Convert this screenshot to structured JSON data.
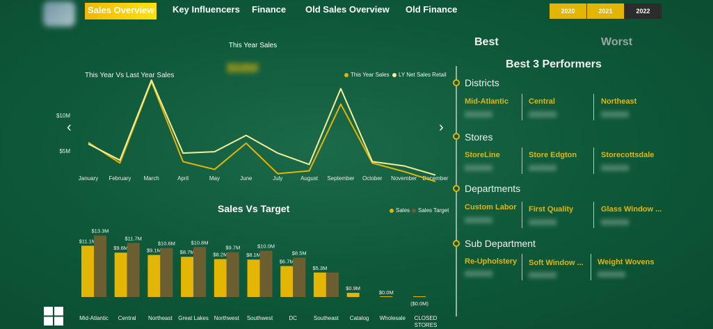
{
  "nav": {
    "tabs": [
      "Sales Overview",
      "Key Influencers",
      "Finance",
      "Old Sales Overview",
      "Old Finance"
    ],
    "years": [
      "2020",
      "2021",
      "2022"
    ]
  },
  "kpi": {
    "title": "This Year Sales",
    "value": "$68M"
  },
  "line_chart": {
    "title": "This Year Vs Last Year Sales",
    "legend": [
      "This Year Sales",
      "LY Net Sales Retail"
    ]
  },
  "bar_chart": {
    "title": "Sales Vs Target",
    "legend": [
      "Sales",
      "Sales Target"
    ]
  },
  "right_panel": {
    "best_label": "Best",
    "worst_label": "Worst",
    "title": "Best 3 Performers",
    "sections": [
      {
        "name": "Districts",
        "items": [
          "Mid-Atlantic",
          "Central",
          "Northeast"
        ]
      },
      {
        "name": "Stores",
        "items": [
          "StoreLine",
          "Store Edgton",
          "Storecottsdale"
        ]
      },
      {
        "name": "Departments",
        "items": [
          "Custom Labor",
          "First Quality",
          "Glass Window ..."
        ]
      },
      {
        "name": "Sub Department",
        "items": [
          "Re-Upholstery",
          "Soft Window ...",
          "Weight Wovens"
        ]
      }
    ]
  },
  "colors": {
    "this_year": "#e3b505",
    "ly": "#f5ee9c",
    "sales": "#e3b505",
    "target": "#6b5f31",
    "accent": "#e3b505"
  },
  "chart_data": [
    {
      "type": "line",
      "title": "This Year Vs Last Year Sales",
      "x": [
        "January",
        "February",
        "March",
        "April",
        "May",
        "June",
        "July",
        "August",
        "September",
        "October",
        "November",
        "December"
      ],
      "yticks": [
        "$5M",
        "$10M"
      ],
      "ylim": [
        0,
        16
      ],
      "series": [
        {
          "name": "This Year Sales",
          "values": [
            6.2,
            3.3,
            14.8,
            3.5,
            2.4,
            6.1,
            1.8,
            2.2,
            11.6,
            3.3,
            2.1,
            0.7
          ]
        },
        {
          "name": "LY Net Sales Retail",
          "values": [
            6.0,
            3.7,
            15.0,
            4.7,
            4.9,
            7.2,
            4.7,
            3.1,
            13.8,
            3.5,
            2.9,
            1.6
          ]
        }
      ]
    },
    {
      "type": "bar",
      "title": "Sales Vs Target",
      "categories": [
        "Mid-Atlantic",
        "Central",
        "Northeast",
        "Great Lakes",
        "Northwest",
        "Southwest",
        "DC",
        "Southeast",
        "Catalog",
        "Wholesale",
        "CLOSED STORES"
      ],
      "ylim": [
        0,
        14
      ],
      "series": [
        {
          "name": "Sales",
          "values": [
            11.1,
            9.6,
            9.1,
            8.7,
            8.2,
            8.1,
            6.7,
            5.3,
            0.9,
            0.0,
            -0.0
          ],
          "labels": [
            "$11.1M",
            "$9.6M",
            "$9.1M",
            "$8.7M",
            "$8.2M",
            "$8.1M",
            "$6.7M",
            "$5.3M",
            "$0.9M",
            "$0.0M",
            "($0.0M)"
          ]
        },
        {
          "name": "Sales Target",
          "values": [
            13.3,
            11.7,
            10.6,
            10.8,
            9.7,
            10.0,
            8.5,
            5.3,
            0,
            0,
            0
          ],
          "labels": [
            "$13.3M",
            "$11.7M",
            "$10.6M",
            "$10.8M",
            "$9.7M",
            "$10.0M",
            "$8.5M",
            "",
            "",
            "",
            ""
          ]
        }
      ]
    }
  ]
}
